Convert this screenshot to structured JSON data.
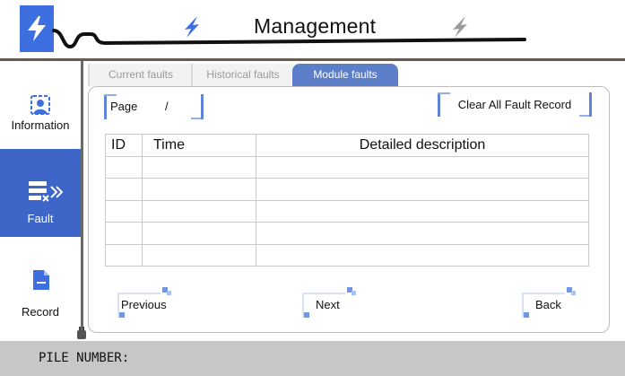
{
  "header": {
    "title": "Management"
  },
  "sidebar": {
    "items": [
      {
        "label": "Information",
        "icon": "information-icon"
      },
      {
        "label": "Fault",
        "icon": "fault-icon"
      },
      {
        "label": "Record",
        "icon": "record-icon"
      }
    ]
  },
  "tabs": [
    {
      "label": "Current faults"
    },
    {
      "label": "Historical faults"
    },
    {
      "label": "Module faults"
    }
  ],
  "toolbar": {
    "page_label": "Page",
    "page_separator": "/",
    "clear_label": "Clear All Fault Record"
  },
  "table": {
    "columns": [
      "ID",
      "Time",
      "Detailed description"
    ],
    "rows": [
      [
        "",
        "",
        ""
      ],
      [
        "",
        "",
        ""
      ],
      [
        "",
        "",
        ""
      ],
      [
        "",
        "",
        ""
      ],
      [
        "",
        "",
        ""
      ]
    ]
  },
  "pagination": {
    "previous_label": "Previous",
    "next_label": "Next",
    "back_label": "Back"
  },
  "footer": {
    "pile_label": "PILE NUMBER:"
  },
  "colors": {
    "accent": "#3e65c8",
    "tab_active": "#5d7fc9",
    "divider_brown": "#6e5846",
    "footer_bg": "#c7c7c7"
  }
}
